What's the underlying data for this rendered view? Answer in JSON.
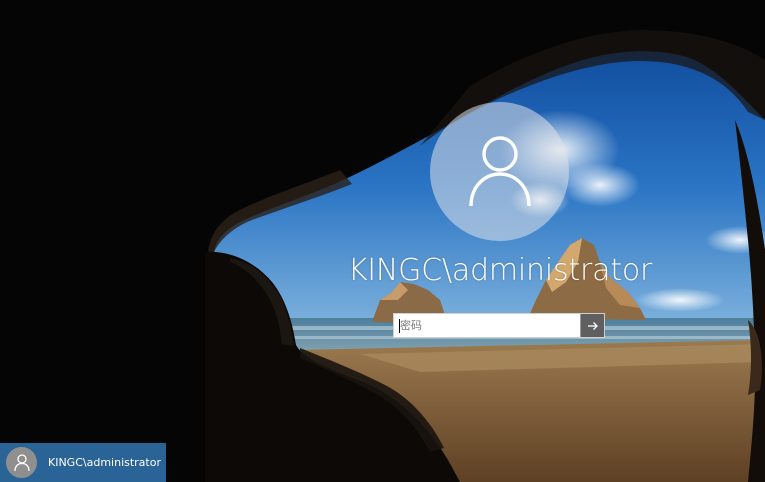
{
  "login": {
    "username": "KINGC\\administrator",
    "password_placeholder": "密码",
    "avatar_icon": "user-icon",
    "submit_icon": "arrow-right-icon"
  },
  "user_tile": {
    "label": "KINGC\\administrator",
    "avatar_icon": "user-icon",
    "accent_color": "#2a6496"
  },
  "background": {
    "subject": "sea cave beach wallpaper"
  }
}
